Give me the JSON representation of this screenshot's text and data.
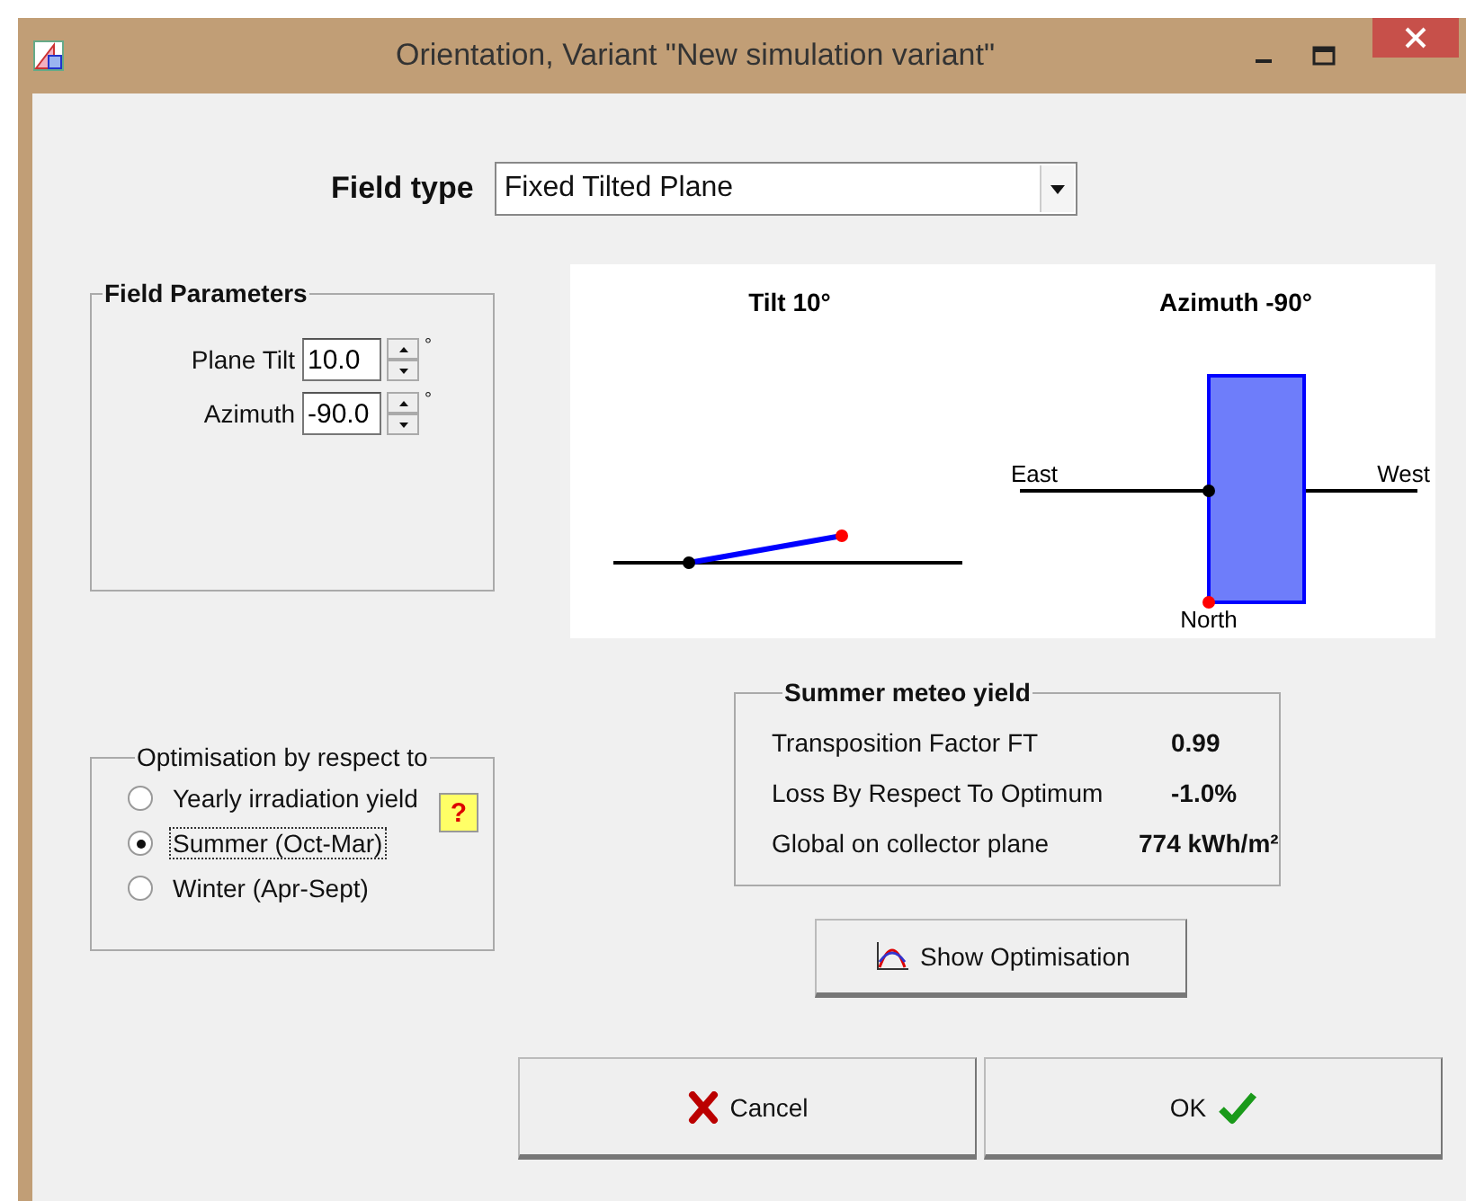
{
  "window": {
    "title": "Orientation, Variant \"New simulation variant\""
  },
  "field_type": {
    "label": "Field type",
    "value": "Fixed Tilted Plane"
  },
  "field_parameters": {
    "title": "Field Parameters",
    "params": [
      {
        "label": "Plane Tilt",
        "value": "10.0",
        "unit": "°"
      },
      {
        "label": "Azimuth",
        "value": "-90.0",
        "unit": "°"
      }
    ]
  },
  "diagram": {
    "tilt_title": "Tilt 10°",
    "azimuth_title": "Azimuth -90°",
    "east": "East",
    "west": "West",
    "north": "North"
  },
  "optimisation": {
    "title": "Optimisation by respect to",
    "help": "?",
    "options": [
      {
        "label": "Yearly irradiation yield",
        "selected": false
      },
      {
        "label": "Summer (Oct-Mar)",
        "selected": true
      },
      {
        "label": "Winter (Apr-Sept)",
        "selected": false
      }
    ]
  },
  "yield": {
    "title": "Summer meteo yield",
    "rows": [
      {
        "label": "Transposition Factor FT",
        "value": "0.99"
      },
      {
        "label": "Loss By Respect To Optimum",
        "value": "-1.0%"
      },
      {
        "label": "Global on collector plane",
        "value": "774 kWh/m²"
      }
    ]
  },
  "show_optimisation": "Show Optimisation",
  "buttons": [
    {
      "label": "Cancel",
      "kind": "cancel"
    },
    {
      "label": "OK",
      "kind": "ok"
    }
  ]
}
